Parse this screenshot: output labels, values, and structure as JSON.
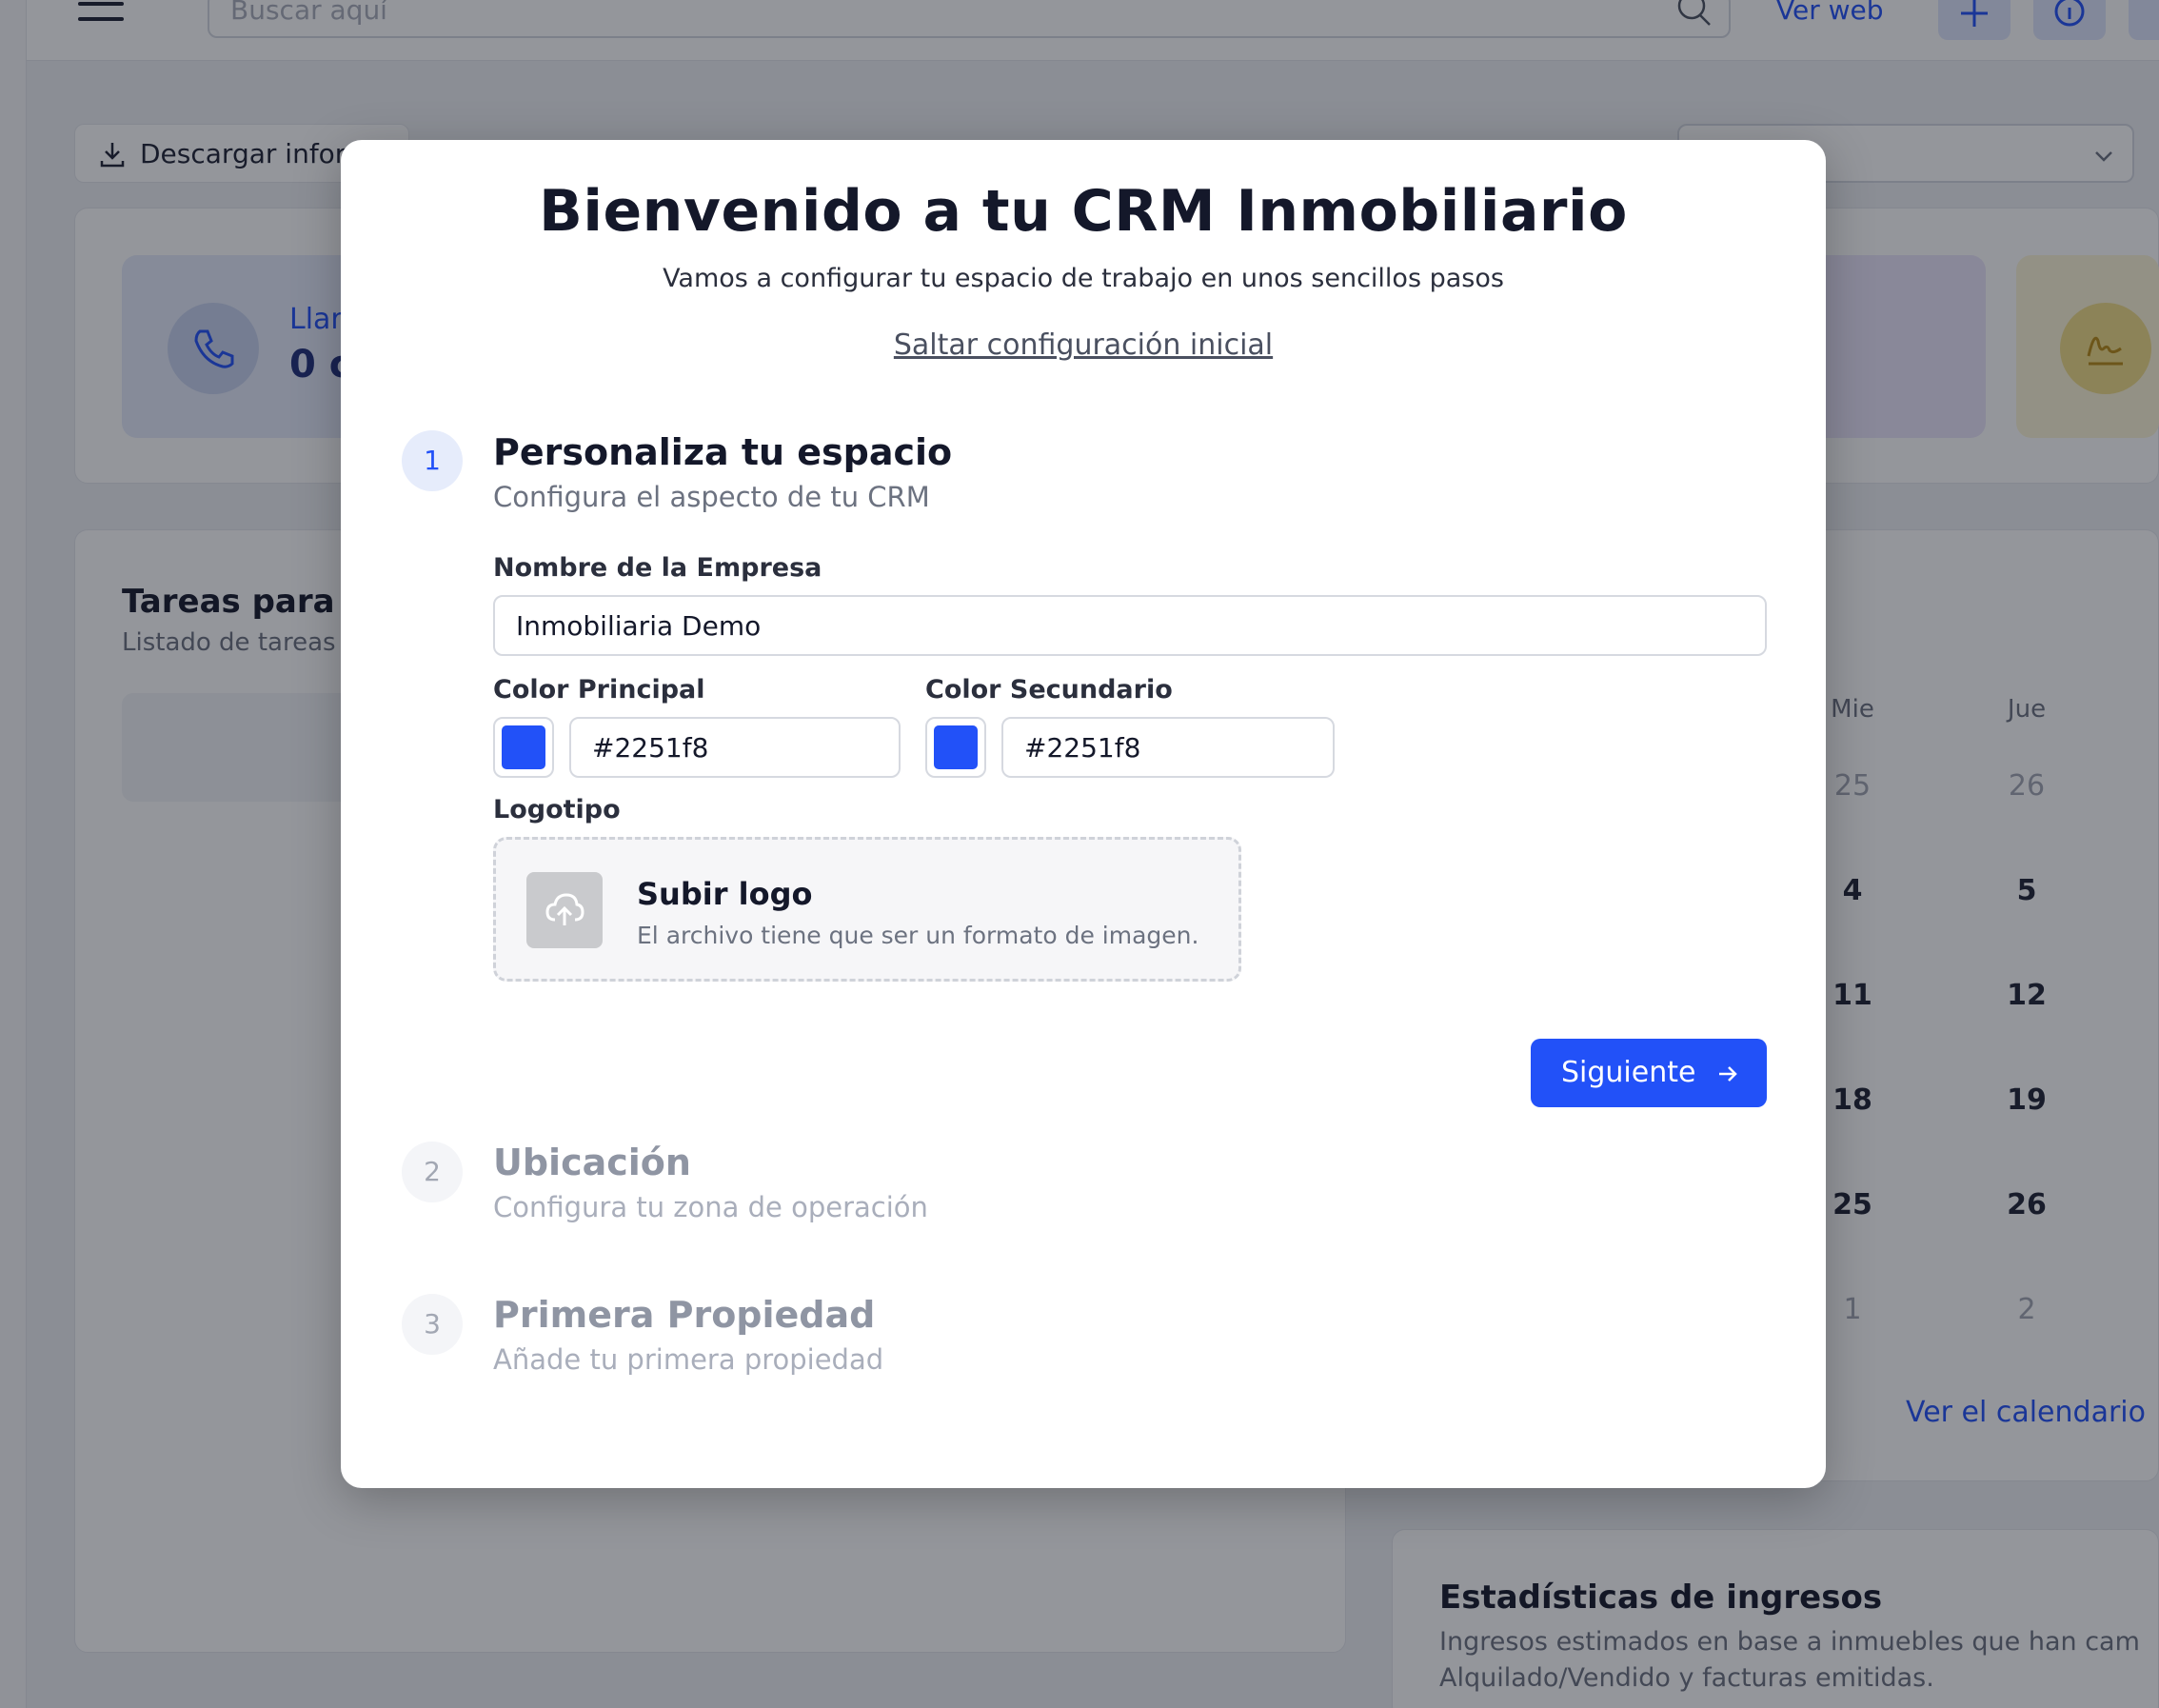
{
  "background": {
    "search_placeholder": "Buscar aquí",
    "ver_web": "Ver web",
    "download_label": "Descargar infor",
    "call_card": {
      "label": "Llar",
      "value": "0 c"
    },
    "tasks": {
      "title": "Tareas para h",
      "subtitle": "Listado de tareas"
    },
    "calendar": {
      "day_headers": [
        "Mie",
        "Jue"
      ],
      "rows": [
        [
          "25",
          "26"
        ],
        [
          "4",
          "5"
        ],
        [
          "11",
          "12"
        ],
        [
          "18",
          "19"
        ],
        [
          "25",
          "26"
        ],
        [
          "1",
          "2"
        ]
      ],
      "link": "Ver el calendario"
    },
    "revenue": {
      "title": "Estadísticas de ingresos",
      "line1": "Ingresos estimados en base a inmuebles que han cam",
      "line2": "Alquilado/Vendido y facturas emitidas."
    }
  },
  "modal": {
    "title": "Bienvenido a tu CRM Inmobiliario",
    "subtitle": "Vamos a configurar tu espacio de trabajo en unos sencillos pasos",
    "skip_link": "Saltar configuración inicial",
    "steps": [
      {
        "number": "1",
        "title": "Personaliza tu espacio",
        "description": "Configura el aspecto de tu CRM",
        "active": true
      },
      {
        "number": "2",
        "title": "Ubicación",
        "description": "Configura tu zona de operación",
        "active": false
      },
      {
        "number": "3",
        "title": "Primera Propiedad",
        "description": "Añade tu primera propiedad",
        "active": false
      }
    ],
    "form": {
      "company_label": "Nombre de la Empresa",
      "company_value": "Inmobiliaria Demo",
      "primary_color_label": "Color Principal",
      "primary_color_value": "#2251f8",
      "secondary_color_label": "Color Secundario",
      "secondary_color_value": "#2251f8",
      "logo_label": "Logotipo",
      "upload_title": "Subir logo",
      "upload_description": "El archivo tiene que ser un formato de imagen."
    },
    "next_button": "Siguiente"
  },
  "colors": {
    "accent": "#2251f8",
    "primary_swatch": "#2251f8",
    "secondary_swatch": "#2251f8"
  }
}
